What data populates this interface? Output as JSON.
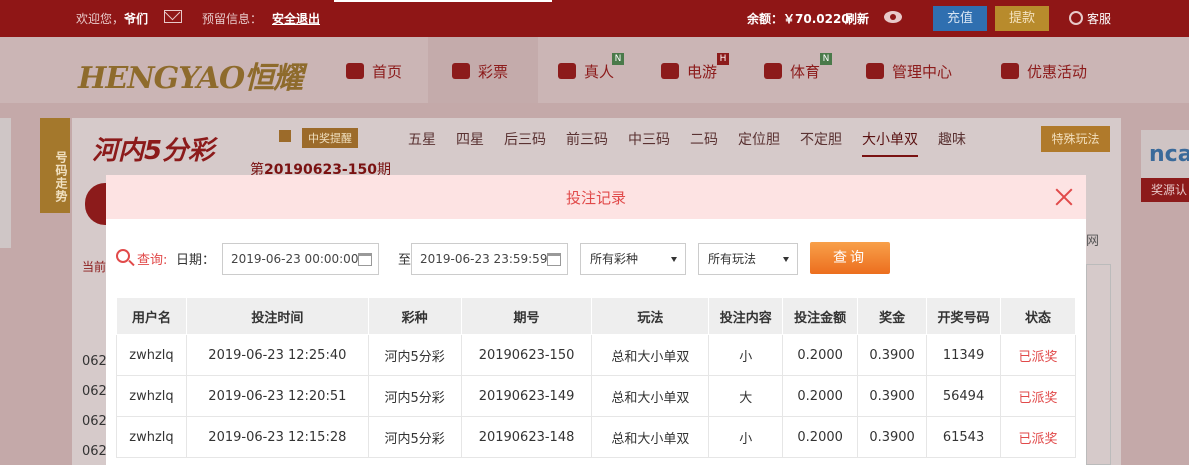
{
  "topbar": {
    "welcome_prefix": "欢迎您，",
    "username": "爷们",
    "notice_label": "预留信息：",
    "logout": "安全退出",
    "balance": "余额：￥70.0220",
    "refresh": "刷新",
    "charge": "充值",
    "withdraw": "提款",
    "service": "客服"
  },
  "nav": {
    "logo": "HENGYAO恒耀",
    "items": [
      {
        "label": "首页",
        "badge": ""
      },
      {
        "label": "彩票",
        "badge": ""
      },
      {
        "label": "真人",
        "badge": "N"
      },
      {
        "label": "电游",
        "badge": "H"
      },
      {
        "label": "体育",
        "badge": "N"
      },
      {
        "label": "管理中心",
        "badge": ""
      },
      {
        "label": "优惠活动",
        "badge": ""
      }
    ]
  },
  "game": {
    "trend_tab": "号码走势",
    "logo": "河内5分彩",
    "win_remind": "中奖提醒",
    "period_prefix": "第",
    "period": "20190623-150",
    "period_suffix": "期",
    "tabs": [
      "五星",
      "四星",
      "后三码",
      "前三码",
      "中三码",
      "二码",
      "定位胆",
      "不定胆",
      "大小单双",
      "趣味"
    ],
    "active_tab": "大小单双",
    "special_play": "特殊玩法",
    "brand_right": "nca",
    "brand_bar": "奖源认",
    "side_label": "当前",
    "side_list": [
      "062",
      "062",
      "062",
      "062"
    ],
    "right_side_text": "网"
  },
  "modal": {
    "title": "投注记录",
    "search": {
      "query_label": "查询:",
      "date_label": "日期：",
      "start_date": "2019-06-23 00:00:00",
      "to_label": "至",
      "end_date": "2019-06-23 23:59:59",
      "lottery_select": "所有彩种",
      "play_select": "所有玩法",
      "button": "查询"
    },
    "table": {
      "headers": [
        "用户名",
        "投注时间",
        "彩种",
        "期号",
        "玩法",
        "投注内容",
        "投注金额",
        "奖金",
        "开奖号码",
        "状态"
      ],
      "rows": [
        [
          "zwhzlq",
          "2019-06-23 12:25:40",
          "河内5分彩",
          "20190623-150",
          "总和大小单双",
          "小",
          "0.2000",
          "0.3900",
          "11349",
          "已派奖"
        ],
        [
          "zwhzlq",
          "2019-06-23 12:20:51",
          "河内5分彩",
          "20190623-149",
          "总和大小单双",
          "大",
          "0.2000",
          "0.3900",
          "56494",
          "已派奖"
        ],
        [
          "zwhzlq",
          "2019-06-23 12:15:28",
          "河内5分彩",
          "20190623-148",
          "总和大小单双",
          "小",
          "0.2000",
          "0.3900",
          "61543",
          "已派奖"
        ]
      ]
    }
  }
}
